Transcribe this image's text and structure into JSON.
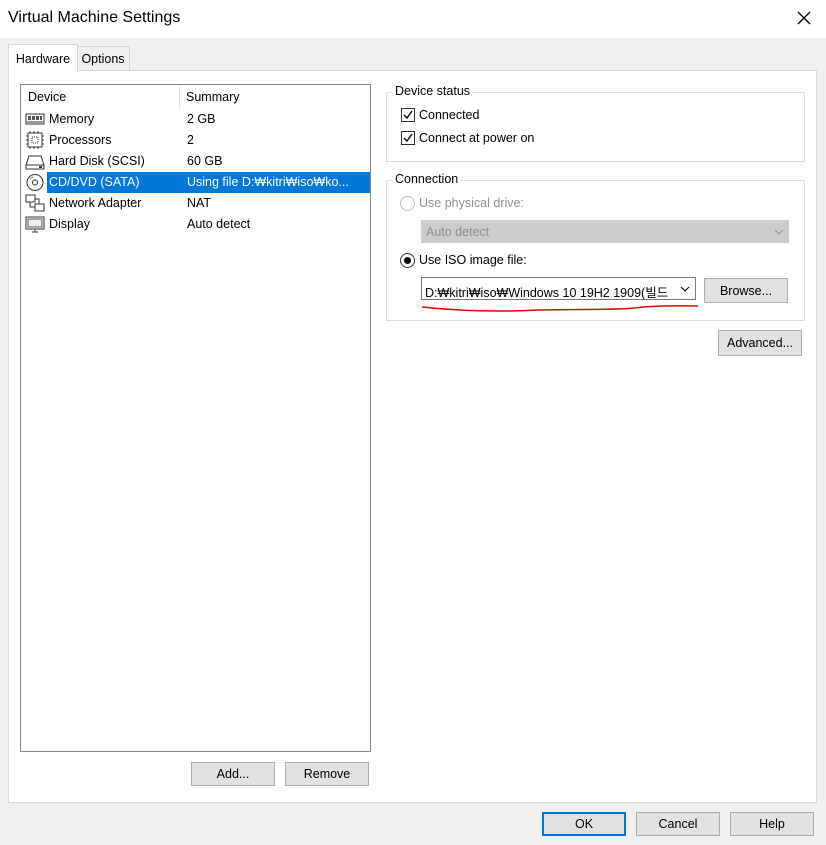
{
  "window": {
    "title": "Virtual Machine Settings"
  },
  "tabs": [
    {
      "label": "Hardware",
      "active": true
    },
    {
      "label": "Options",
      "active": false
    }
  ],
  "device_list": {
    "columns": {
      "device": "Device",
      "summary": "Summary"
    },
    "rows": [
      {
        "device": "Memory",
        "summary": "2 GB",
        "icon": "memory-icon"
      },
      {
        "device": "Processors",
        "summary": "2",
        "icon": "processor-icon"
      },
      {
        "device": "Hard Disk (SCSI)",
        "summary": "60 GB",
        "icon": "hard-disk-icon"
      },
      {
        "device": "CD/DVD (SATA)",
        "summary": "Using file D:₩kitri₩iso₩ko...",
        "icon": "cd-dvd-icon",
        "selected": true
      },
      {
        "device": "Network Adapter",
        "summary": "NAT",
        "icon": "network-adapter-icon"
      },
      {
        "device": "Display",
        "summary": "Auto detect",
        "icon": "display-icon"
      }
    ]
  },
  "list_buttons": {
    "add": "Add...",
    "remove": "Remove"
  },
  "device_status": {
    "legend": "Device status",
    "connected": {
      "label": "Connected",
      "checked": true
    },
    "connect_power_on": {
      "label": "Connect at power on",
      "checked": true
    }
  },
  "connection": {
    "legend": "Connection",
    "physical": {
      "label": "Use physical drive:",
      "selected": false,
      "enabled": false
    },
    "physical_drive_value": "Auto detect",
    "iso": {
      "label": "Use ISO image file:",
      "selected": true
    },
    "iso_path": "D:₩kitri₩iso₩Windows 10 19H2 1909(빌드",
    "browse_label": "Browse..."
  },
  "advanced_label": "Advanced...",
  "dialog_buttons": {
    "ok": "OK",
    "cancel": "Cancel",
    "help": "Help"
  },
  "colors": {
    "selection": "#0078d7",
    "annotation": "#e00000",
    "panel": "#ffffff",
    "dialog": "#f0f0f0"
  }
}
